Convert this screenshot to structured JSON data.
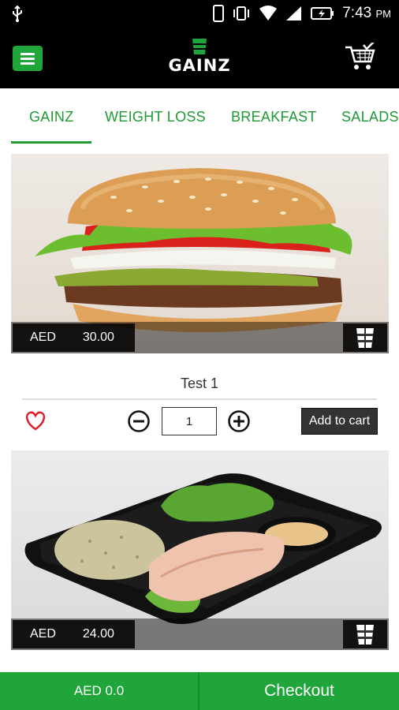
{
  "status_bar": {
    "time": "7:43",
    "ampm": "PM"
  },
  "app": {
    "logo_text": "GAINZ"
  },
  "tabs": [
    {
      "label": "GAINZ",
      "active": true
    },
    {
      "label": "WEIGHT LOSS",
      "active": false
    },
    {
      "label": "BREAKFAST",
      "active": false
    },
    {
      "label": "SALADS",
      "active": false
    }
  ],
  "products": [
    {
      "name": "Test 1",
      "currency": "AED",
      "price": "30.00",
      "quantity": "1",
      "add_to_cart_label": "Add to cart",
      "image_icon": "burger-image"
    },
    {
      "currency": "AED",
      "price": "24.00",
      "image_icon": "salmon-meal-image"
    }
  ],
  "footer": {
    "total": "AED 0.0",
    "checkout_label": "Checkout"
  },
  "colors": {
    "brand_green": "#1fa53a",
    "tab_green": "#1f9a35",
    "dark": "#000000"
  }
}
